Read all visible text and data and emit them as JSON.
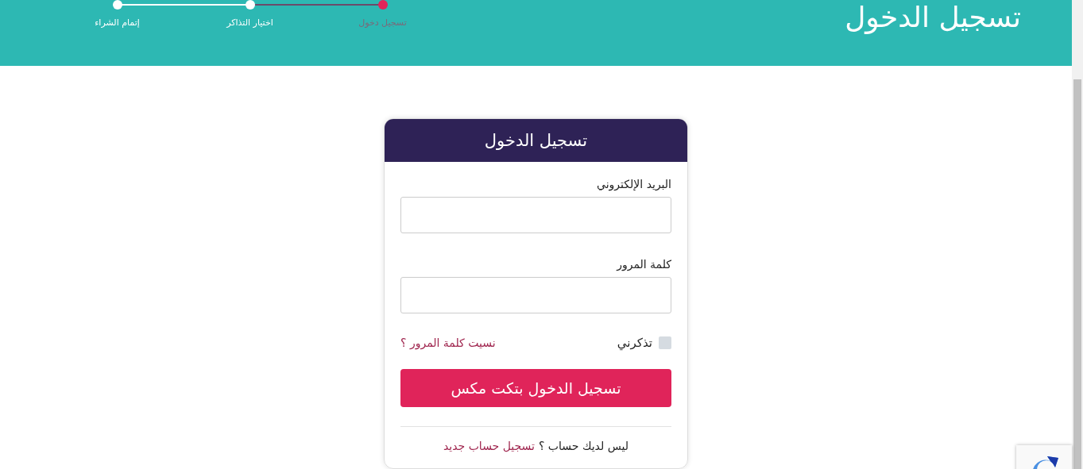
{
  "header": {
    "title": "تسجيل الدخول"
  },
  "steps": [
    {
      "label": "تسجيل دخول",
      "selected": true
    },
    {
      "label": "اختيار التذاكر",
      "selected": false
    },
    {
      "label": "إتمام الشراء",
      "selected": false
    }
  ],
  "login_card": {
    "title": "تسجيل الدخول",
    "fields": [
      {
        "label": "البريد الإلكتروني"
      },
      {
        "label": "كلمة المرور"
      }
    ],
    "remember": {
      "label": "تذكرني",
      "checked": false
    },
    "forgot_link": "نسيت كلمة المرور ؟",
    "submit_button": "تسجيل الدخول بتكت مكس",
    "register": {
      "text": "ليس لديك حساب ؟",
      "link": "تسجيل حساب جديد"
    }
  }
}
